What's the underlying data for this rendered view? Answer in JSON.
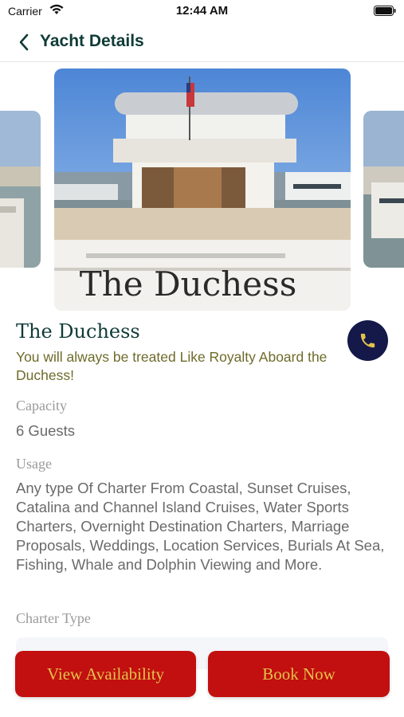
{
  "status_bar": {
    "carrier": "Carrier",
    "time": "12:44 AM",
    "icons": [
      "wifi-icon",
      "battery-icon"
    ]
  },
  "nav": {
    "back_icon": "chevron-left-icon",
    "title": "Yacht Details"
  },
  "gallery": {
    "images": [
      "yacht stern photo",
      "marina photo",
      "yacht side photo"
    ],
    "stern_lettering": "The Duchess"
  },
  "yacht": {
    "name": "The Duchess",
    "tagline": "You will always be treated Like Royalty Aboard the Duchess!",
    "call_icon": "phone-icon"
  },
  "details": {
    "capacity_label": "Capacity",
    "capacity_value": "6 Guests",
    "usage_label": "Usage",
    "usage_value": "Any type Of Charter From Coastal, Sunset Cruises, Catalina and Channel Island Cruises, Water Sports Charters, Overnight Destination Charters, Marriage Proposals, Weddings, Location Services, Burials At Sea, Fishing, Whale and Dolphin Viewing and More.",
    "charter_type_label": "Charter Type"
  },
  "actions": {
    "view_availability": "View Availability",
    "book_now": "Book Now"
  },
  "colors": {
    "title_green": "#0f3b36",
    "tagline_olive": "#6e6b2a",
    "button_red": "#c20f0f",
    "button_text_gold": "#e3c24a",
    "call_navy": "#14194a"
  }
}
